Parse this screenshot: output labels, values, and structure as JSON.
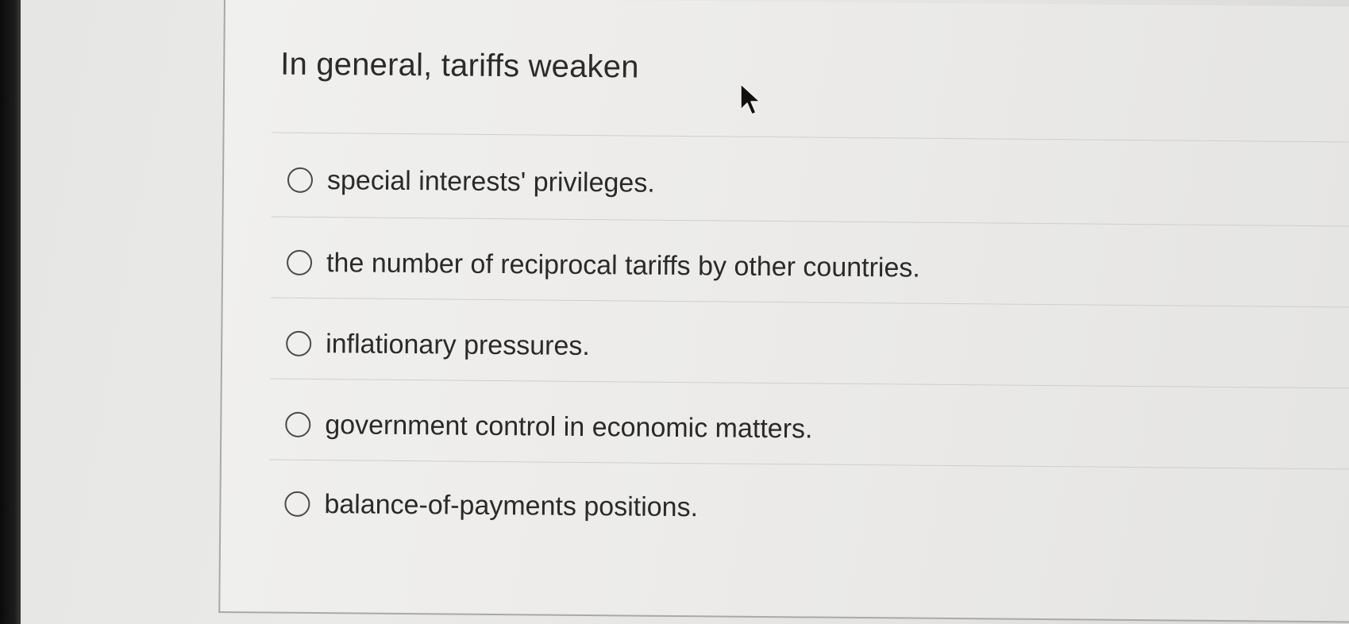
{
  "quiz": {
    "question": "In general, tariffs weaken",
    "options": [
      {
        "label": "special interests' privileges.",
        "selected": false
      },
      {
        "label": "the number of reciprocal tariffs by other countries.",
        "selected": false
      },
      {
        "label": "inflationary pressures.",
        "selected": false
      },
      {
        "label": "government control in economic matters.",
        "selected": false
      },
      {
        "label": "balance-of-payments positions.",
        "selected": false
      }
    ]
  },
  "icons": {
    "cursor": "mouse-pointer-arrow-icon",
    "radio": "radio-unchecked-icon"
  },
  "colors": {
    "text": "#2b2b2b",
    "radio_border": "#4a4a4a",
    "divider": "#cfcfcd",
    "panel_background": "#ecebe9"
  }
}
